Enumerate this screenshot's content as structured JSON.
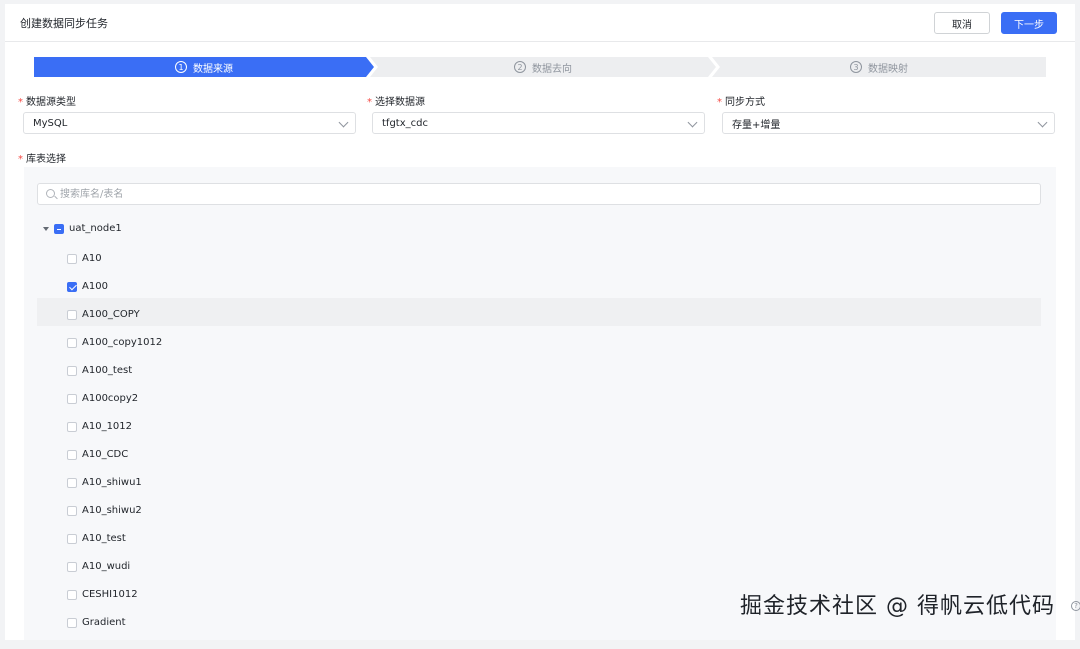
{
  "header": {
    "title": "创建数据同步任务",
    "cancel_label": "取消",
    "next_label": "下一步"
  },
  "steps": [
    {
      "num": "1",
      "label": "数据来源",
      "active": true
    },
    {
      "num": "2",
      "label": "数据去向",
      "active": false
    },
    {
      "num": "3",
      "label": "数据映射",
      "active": false
    }
  ],
  "form": {
    "source_type": {
      "label": "数据源类型",
      "value": "MySQL"
    },
    "datasource": {
      "label": "选择数据源",
      "value": "tfgtx_cdc"
    },
    "sync_mode": {
      "label": "同步方式",
      "value": "存量+增量"
    },
    "table_select": {
      "label": "库表选择"
    }
  },
  "tree": {
    "search_placeholder": "搜索库名/表名",
    "root": {
      "label": "uat_node1",
      "state": "indeterminate",
      "expanded": true
    },
    "items": [
      {
        "label": "A10",
        "checked": false
      },
      {
        "label": "A100",
        "checked": true
      },
      {
        "label": "A100_COPY",
        "checked": false
      },
      {
        "label": "A100_copy1012",
        "checked": false
      },
      {
        "label": "A100_test",
        "checked": false
      },
      {
        "label": "A100copy2",
        "checked": false
      },
      {
        "label": "A10_1012",
        "checked": false
      },
      {
        "label": "A10_CDC",
        "checked": false
      },
      {
        "label": "A10_shiwu1",
        "checked": false
      },
      {
        "label": "A10_shiwu2",
        "checked": false
      },
      {
        "label": "A10_test",
        "checked": false
      },
      {
        "label": "A10_wudi",
        "checked": false
      },
      {
        "label": "CESHI1012",
        "checked": false
      },
      {
        "label": "Gradient",
        "checked": false
      }
    ]
  },
  "watermark": "掘金技术社区 @ 得帆云低代码",
  "help_glyph": "?",
  "colors": {
    "accent": "#3a6ef5",
    "required": "#f54a45"
  }
}
